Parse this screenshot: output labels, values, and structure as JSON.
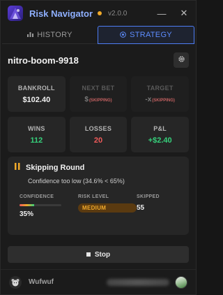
{
  "app": {
    "title": "Risk Navigator",
    "version": "v2.0.0",
    "status_color": "#f0a92a",
    "minimize_symbol": "—",
    "close_symbol": "✕"
  },
  "tabs": [
    {
      "label": "HISTORY",
      "icon": "bar-chart-icon",
      "active": false
    },
    {
      "label": "STRATEGY",
      "icon": "target-icon",
      "active": true
    }
  ],
  "session": {
    "name": "nitro-boom-9918"
  },
  "stats": {
    "bankroll": {
      "label": "BANKROLL",
      "value": "$102.40"
    },
    "next_bet": {
      "label": "NEXT BET",
      "value": "$",
      "tag": "(SKIPPING)"
    },
    "target": {
      "label": "TARGET",
      "value": "-x",
      "tag": "(SKIPPING)"
    },
    "wins": {
      "label": "WINS",
      "value": "112"
    },
    "losses": {
      "label": "LOSSES",
      "value": "20"
    },
    "pnl": {
      "label": "P&L",
      "value": "+$2.40"
    }
  },
  "status": {
    "title": "Skipping Round",
    "subtitle": "Confidence too low (34.6% < 65%)",
    "confidence": {
      "label": "CONFIDENCE",
      "value": "35%",
      "fill_fraction": 0.35
    },
    "risk": {
      "label": "RISK LEVEL",
      "value": "MEDIUM"
    },
    "skipped": {
      "label": "SKIPPED",
      "value": "55"
    }
  },
  "stop_button": {
    "label": "Stop"
  },
  "footer": {
    "username": "Wufwuf"
  },
  "colors": {
    "accent": "#5e8dff",
    "warning": "#f0a92a",
    "positive": "#36d07b",
    "negative": "#ef5a5a"
  }
}
